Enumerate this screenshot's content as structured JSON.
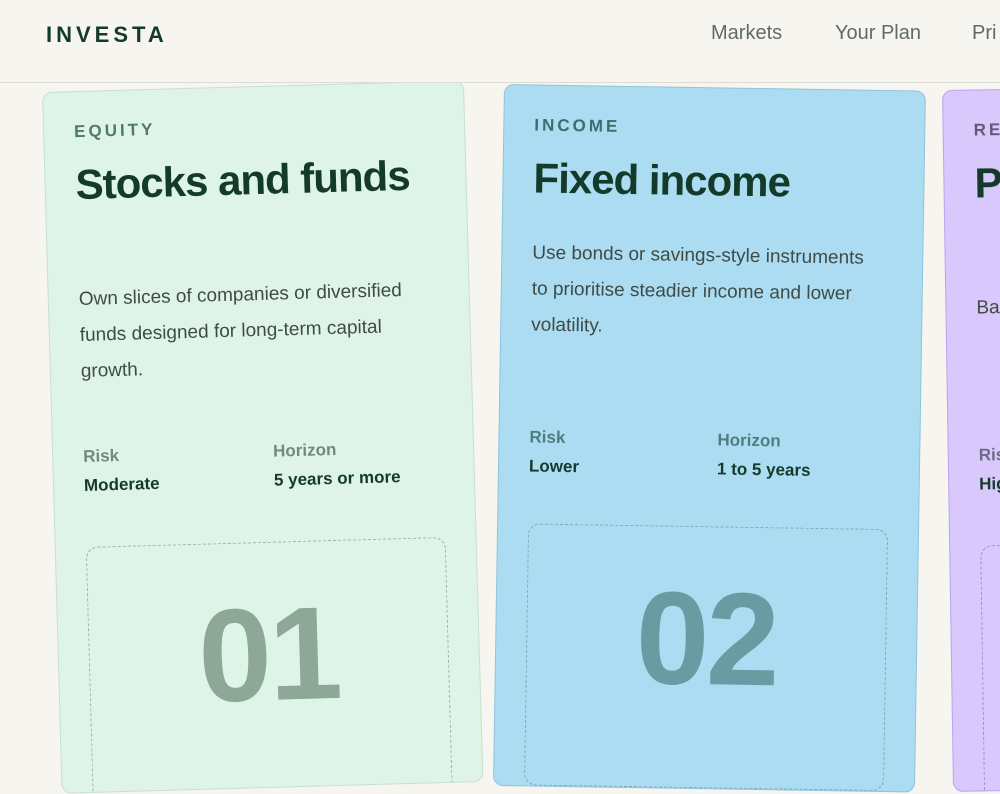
{
  "header": {
    "logo": "INVESTA",
    "nav": [
      "Markets",
      "Your Plan",
      "Pri"
    ]
  },
  "cards": [
    {
      "eyebrow": "EQUITY",
      "title": "Stocks and funds",
      "description": "Own slices of companies or diversified funds designed for long-term capital growth.",
      "risk_label": "Risk",
      "risk_value": "Moderate",
      "horizon_label": "Horizon",
      "horizon_value": "5 years or more",
      "number": "01"
    },
    {
      "eyebrow": "INCOME",
      "title": "Fixed income",
      "description": "Use bonds or savings-style instruments to prioritise steadier income and lower volatility.",
      "risk_label": "Risk",
      "risk_value": "Lower",
      "horizon_label": "Horizon",
      "horizon_value": "1 to 5 years",
      "number": "02"
    },
    {
      "eyebrow": "RE",
      "title": "P a",
      "description": "Ba liq dif",
      "risk_label": "Risk",
      "risk_value": "Hig"
    }
  ],
  "colors": {
    "background": "#f6f5ef",
    "equity_card": "#dff4e8",
    "income_card": "#abdcf2",
    "reserve_card": "#d8c8fb",
    "heading": "#143a2a"
  }
}
